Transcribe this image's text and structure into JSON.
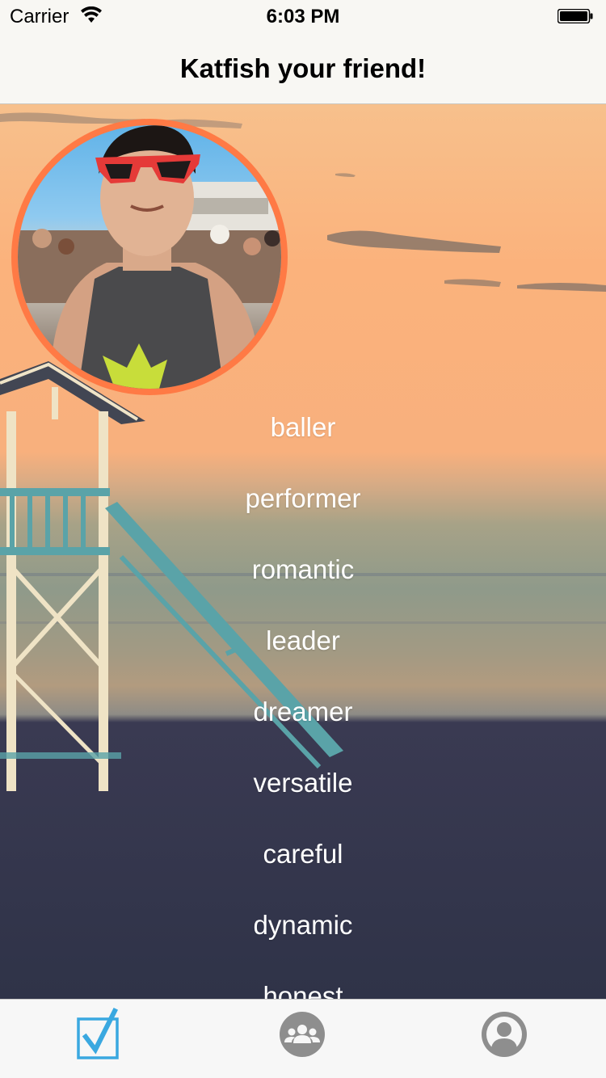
{
  "status_bar": {
    "carrier": "Carrier",
    "time": "6:03 PM",
    "wifi_icon": "wifi-icon",
    "battery_icon": "battery-icon"
  },
  "nav": {
    "title": "Katfish your friend!"
  },
  "traits": [
    "baller",
    "performer",
    "romantic",
    "leader",
    "dreamer",
    "versatile",
    "careful",
    "dynamic",
    "honest"
  ],
  "tabs": [
    {
      "icon": "checklist-icon",
      "active": true
    },
    {
      "icon": "friends-group-icon",
      "active": false
    },
    {
      "icon": "profile-icon",
      "active": false
    }
  ],
  "colors": {
    "accent": "#3aa8e0",
    "avatar_ring": "#ff7a45",
    "tab_inactive": "#8e8e8e"
  }
}
